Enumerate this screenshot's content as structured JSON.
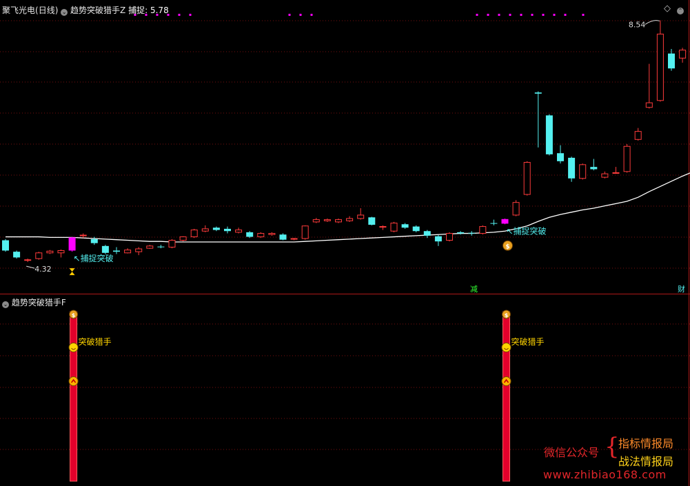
{
  "header": {
    "stock_name": "聚飞光电",
    "period": "(日线)",
    "indicator_main": "趋势突破猎手Z",
    "capture_label": "捕捉:",
    "capture_value": "5.78"
  },
  "sub_header": {
    "indicator_sub": "趋势突破猎手F"
  },
  "corner_labels": {
    "jian": "减",
    "cai": "财"
  },
  "colors": {
    "up": "#ff3b3b",
    "down": "#54f0f0",
    "signal": "#ff00ff",
    "ma": "#ffffff",
    "grid": "#7a1010",
    "bar_red": "#e3002b",
    "label_cyan": "#54f0f0",
    "label_yellow": "#ffd400"
  },
  "chart_data": {
    "type": "candlestick",
    "ylim": [
      3.9,
      8.75
    ],
    "min_label": "4.32",
    "max_label": "8.54",
    "candles": [
      {
        "o": 4.7,
        "h": 4.72,
        "l": 4.5,
        "c": 4.52
      },
      {
        "o": 4.5,
        "h": 4.52,
        "l": 4.38,
        "c": 4.4
      },
      {
        "o": 4.35,
        "h": 4.38,
        "l": 4.32,
        "c": 4.36
      },
      {
        "o": 4.38,
        "h": 4.5,
        "l": 4.36,
        "c": 4.48
      },
      {
        "o": 4.48,
        "h": 4.53,
        "l": 4.46,
        "c": 4.51
      },
      {
        "o": 4.48,
        "h": 4.54,
        "l": 4.4,
        "c": 4.52
      },
      {
        "o": 4.52,
        "h": 4.76,
        "l": 4.5,
        "c": 4.75,
        "sig": true
      },
      {
        "o": 4.78,
        "h": 4.82,
        "l": 4.74,
        "c": 4.79
      },
      {
        "o": 4.72,
        "h": 4.76,
        "l": 4.62,
        "c": 4.65
      },
      {
        "o": 4.6,
        "h": 4.62,
        "l": 4.46,
        "c": 4.48
      },
      {
        "o": 4.52,
        "h": 4.58,
        "l": 4.46,
        "c": 4.5
      },
      {
        "o": 4.48,
        "h": 4.56,
        "l": 4.47,
        "c": 4.53
      },
      {
        "o": 4.5,
        "h": 4.58,
        "l": 4.44,
        "c": 4.55
      },
      {
        "o": 4.56,
        "h": 4.62,
        "l": 4.55,
        "c": 4.6
      },
      {
        "o": 4.59,
        "h": 4.62,
        "l": 4.56,
        "c": 4.58
      },
      {
        "o": 4.58,
        "h": 4.72,
        "l": 4.56,
        "c": 4.7
      },
      {
        "o": 4.7,
        "h": 4.77,
        "l": 4.68,
        "c": 4.76
      },
      {
        "o": 4.76,
        "h": 4.9,
        "l": 4.74,
        "c": 4.88
      },
      {
        "o": 4.86,
        "h": 4.96,
        "l": 4.84,
        "c": 4.9
      },
      {
        "o": 4.92,
        "h": 4.94,
        "l": 4.86,
        "c": 4.88
      },
      {
        "o": 4.9,
        "h": 4.94,
        "l": 4.82,
        "c": 4.86
      },
      {
        "o": 4.84,
        "h": 4.92,
        "l": 4.82,
        "c": 4.88
      },
      {
        "o": 4.84,
        "h": 4.86,
        "l": 4.74,
        "c": 4.76
      },
      {
        "o": 4.76,
        "h": 4.84,
        "l": 4.74,
        "c": 4.82
      },
      {
        "o": 4.8,
        "h": 4.84,
        "l": 4.78,
        "c": 4.82
      },
      {
        "o": 4.8,
        "h": 4.82,
        "l": 4.7,
        "c": 4.71
      },
      {
        "o": 4.72,
        "h": 4.74,
        "l": 4.7,
        "c": 4.73
      },
      {
        "o": 4.73,
        "h": 4.96,
        "l": 4.71,
        "c": 4.95
      },
      {
        "o": 5.02,
        "h": 5.09,
        "l": 5.0,
        "c": 5.06
      },
      {
        "o": 5.04,
        "h": 5.08,
        "l": 5.02,
        "c": 5.06
      },
      {
        "o": 5.02,
        "h": 5.08,
        "l": 5.0,
        "c": 5.06
      },
      {
        "o": 5.04,
        "h": 5.12,
        "l": 5.02,
        "c": 5.08
      },
      {
        "o": 5.08,
        "h": 5.26,
        "l": 5.06,
        "c": 5.14
      },
      {
        "o": 5.1,
        "h": 5.11,
        "l": 4.96,
        "c": 4.97
      },
      {
        "o": 4.94,
        "h": 4.96,
        "l": 4.88,
        "c": 4.94
      },
      {
        "o": 4.86,
        "h": 5.02,
        "l": 4.84,
        "c": 5.0
      },
      {
        "o": 4.98,
        "h": 5.0,
        "l": 4.9,
        "c": 4.92
      },
      {
        "o": 4.94,
        "h": 4.96,
        "l": 4.84,
        "c": 4.86
      },
      {
        "o": 4.86,
        "h": 4.88,
        "l": 4.74,
        "c": 4.78
      },
      {
        "o": 4.77,
        "h": 4.79,
        "l": 4.6,
        "c": 4.68
      },
      {
        "o": 4.7,
        "h": 4.84,
        "l": 4.68,
        "c": 4.82
      },
      {
        "o": 4.84,
        "h": 4.86,
        "l": 4.8,
        "c": 4.82
      },
      {
        "o": 4.83,
        "h": 4.86,
        "l": 4.78,
        "c": 4.82
      },
      {
        "o": 4.82,
        "h": 4.96,
        "l": 4.8,
        "c": 4.94
      },
      {
        "o": 5.0,
        "h": 5.06,
        "l": 4.96,
        "c": 4.99
      },
      {
        "o": 4.99,
        "h": 5.08,
        "l": 4.98,
        "c": 5.07,
        "sig": true
      },
      {
        "o": 5.14,
        "h": 5.4,
        "l": 5.12,
        "c": 5.36
      },
      {
        "o": 5.5,
        "h": 6.08,
        "l": 5.48,
        "c": 6.06
      },
      {
        "o": 7.28,
        "h": 7.3,
        "l": 6.32,
        "c": 7.26
      },
      {
        "o": 6.88,
        "h": 6.9,
        "l": 6.18,
        "c": 6.2
      },
      {
        "o": 6.22,
        "h": 6.36,
        "l": 6.04,
        "c": 6.08
      },
      {
        "o": 6.14,
        "h": 6.16,
        "l": 5.72,
        "c": 5.78
      },
      {
        "o": 5.78,
        "h": 6.04,
        "l": 5.76,
        "c": 6.02
      },
      {
        "o": 5.98,
        "h": 6.12,
        "l": 5.92,
        "c": 5.94
      },
      {
        "o": 5.8,
        "h": 5.9,
        "l": 5.78,
        "c": 5.86
      },
      {
        "o": 5.88,
        "h": 5.98,
        "l": 5.86,
        "c": 5.88
      },
      {
        "o": 5.9,
        "h": 6.38,
        "l": 5.88,
        "c": 6.34
      },
      {
        "o": 6.46,
        "h": 6.66,
        "l": 6.44,
        "c": 6.6
      },
      {
        "o": 7.02,
        "h": 7.78,
        "l": 7.0,
        "c": 7.1
      },
      {
        "o": 7.14,
        "h": 8.54,
        "l": 7.12,
        "c": 8.3
      },
      {
        "o": 7.96,
        "h": 8.04,
        "l": 7.66,
        "c": 7.7
      },
      {
        "o": 7.88,
        "h": 8.06,
        "l": 7.8,
        "c": 8.02
      },
      {
        "o": 8.16,
        "h": 8.26,
        "l": 7.88,
        "c": 7.94
      }
    ],
    "ma": [
      4.76,
      4.76,
      4.76,
      4.76,
      4.75,
      4.75,
      4.75,
      4.74,
      4.73,
      4.72,
      4.71,
      4.7,
      4.69,
      4.68,
      4.68,
      4.67,
      4.67,
      4.67,
      4.67,
      4.67,
      4.67,
      4.67,
      4.67,
      4.67,
      4.67,
      4.67,
      4.67,
      4.68,
      4.69,
      4.7,
      4.71,
      4.72,
      4.73,
      4.74,
      4.75,
      4.76,
      4.77,
      4.78,
      4.79,
      4.8,
      4.81,
      4.82,
      4.82,
      4.83,
      4.84,
      4.86,
      4.9,
      4.95,
      5.03,
      5.1,
      5.15,
      5.19,
      5.23,
      5.26,
      5.3,
      5.34,
      5.38,
      5.45,
      5.55,
      5.64,
      5.73,
      5.82,
      5.9
    ],
    "signal_label": "捕捉突破",
    "sub_signal_label": "突破猎手"
  },
  "watermark": {
    "wechat": "微信公众号",
    "brace": "{",
    "line1": "指标情报局",
    "line2": "战法情报局",
    "url": "www.zhibiao168.com"
  }
}
